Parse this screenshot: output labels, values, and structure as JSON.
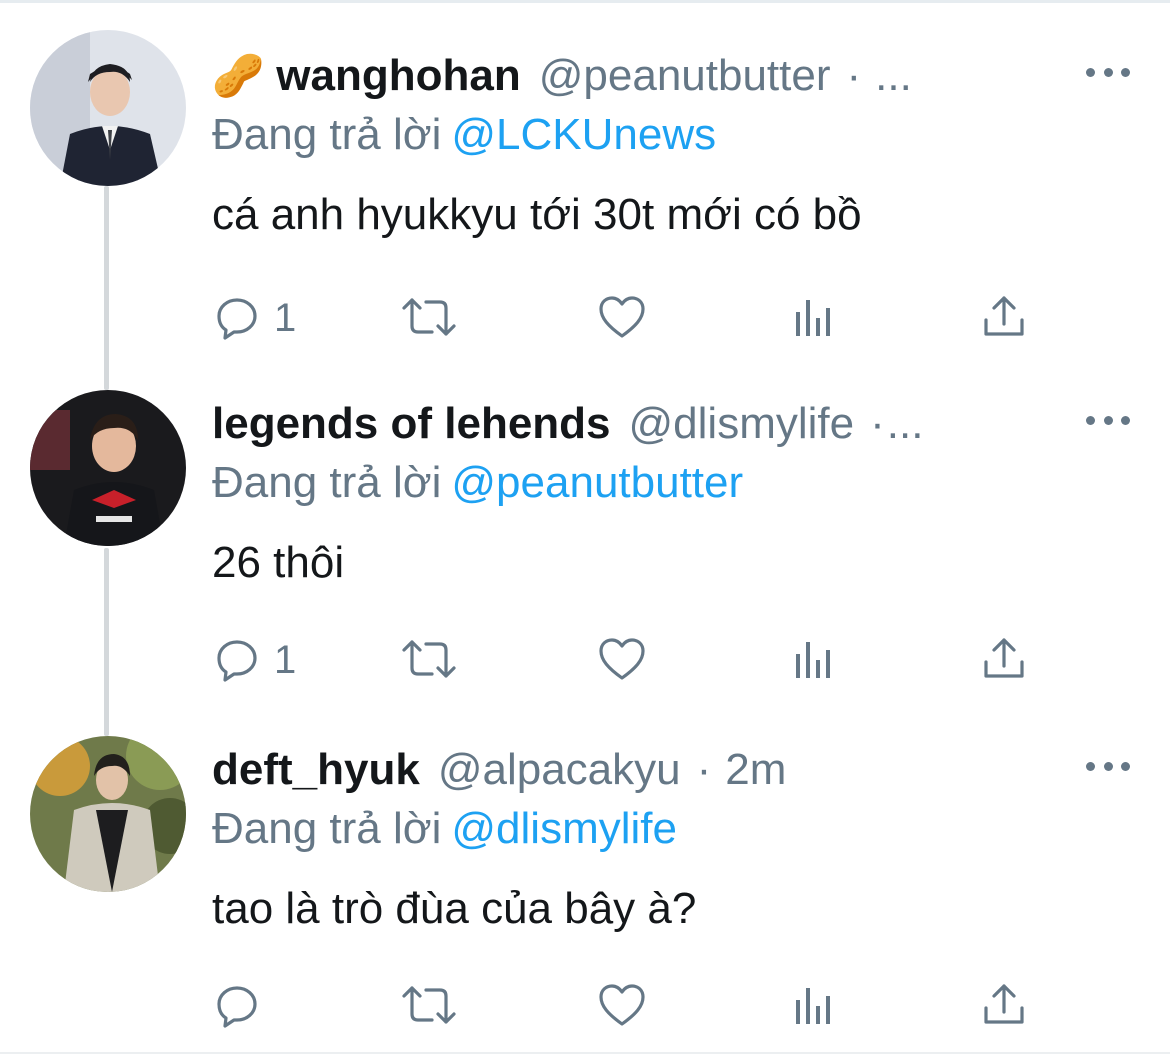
{
  "reply_prefix": "Đang trả lời",
  "tweets": [
    {
      "emoji": "🥜",
      "display_name": "wanghohan",
      "handle": "@peanutbutter",
      "separator": "·",
      "time": "",
      "ellipsis": "...",
      "reply_to": "@LCKUnews",
      "text": "cá anh hyukkyu tới 30t mới có bồ",
      "reply_count": "1"
    },
    {
      "emoji": "",
      "display_name": "legends of lehends",
      "handle": "@dlismylife",
      "separator": "·",
      "time": "",
      "ellipsis": "...",
      "reply_to": "@peanutbutter",
      "text": "26 thôi",
      "reply_count": "1"
    },
    {
      "emoji": "",
      "display_name": "deft_hyuk",
      "handle": "@alpacakyu",
      "separator": "·",
      "time": "2m",
      "ellipsis": "",
      "reply_to": "@dlismylife",
      "text": "tao là trò đùa của bây à?",
      "reply_count": ""
    }
  ],
  "colors": {
    "text": "#14171a",
    "secondary": "#657786",
    "link": "#1da1f2",
    "thread_line": "#d4d8db"
  },
  "icons": [
    "reply-icon",
    "retweet-icon",
    "like-icon",
    "analytics-icon",
    "share-icon",
    "more-icon",
    "peanut-emoji"
  ]
}
